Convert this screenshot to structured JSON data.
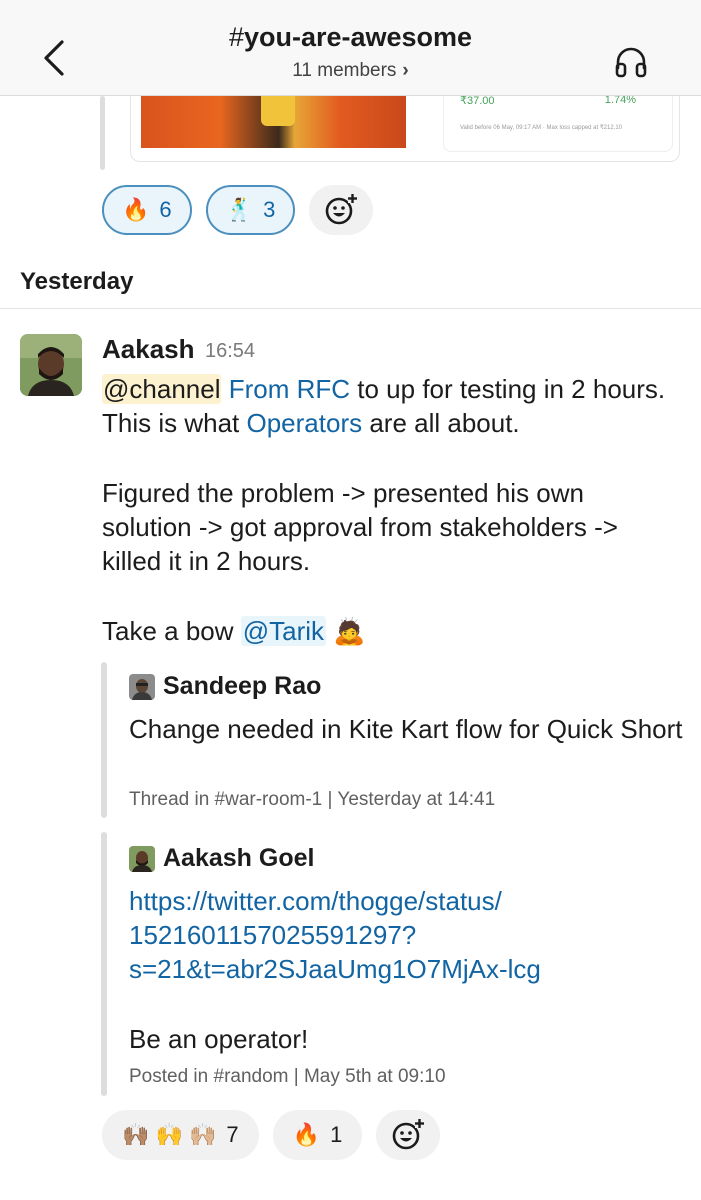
{
  "header": {
    "hash": "#",
    "channel": "you-are-awesome",
    "members": "11 members",
    "members_chevron": "›",
    "back_icon": "chevron-left-icon",
    "audio_icon": "headphones-icon"
  },
  "previous_message": {
    "card_value_left": "₹37.00",
    "card_value_right": "1.74%",
    "card_note": "Valid before 06 May, 09:17 AM · Max loss capped at ₹212.10",
    "reactions": [
      {
        "emoji": "🔥",
        "count": "6",
        "active": true
      },
      {
        "emoji": "🕺",
        "count": "3",
        "active": true
      }
    ]
  },
  "divider_label": "Yesterday",
  "message": {
    "sender": "Aakash",
    "time": "16:54",
    "channel_mention": "@channel",
    "link_rfc": "From RFC",
    "line1_rest": " to up for testing in 2 hours. This is what ",
    "link_operators": "Operators",
    "line1_end": " are all about.",
    "paragraph2": "Figured the problem -> presented his own solution -> got approval from stakeholders -> killed it in 2 hours.",
    "bow_text": "Take a bow ",
    "user_mention": "@Tarik",
    "bow_emoji": "🙇",
    "quotes": [
      {
        "author": "Sandeep Rao",
        "text": "Change needed in Kite Kart flow for Quick Short",
        "meta": "Thread in #war-room-1 | Yesterday at 14:41"
      },
      {
        "author": "Aakash Goel",
        "link": "https://twitter.com/thogge/status/1521601157025591297?s=21&t=abr2SJaaUmg1O7MjAx-lcg",
        "link_line1": "https://twitter.com/thogge/status/",
        "link_line2": "1521601157025591297?",
        "link_line3": "s=21&t=abr2SJaaUmg1O7MjAx-lcg",
        "text": "Be an operator!",
        "meta": "Posted in #random | May 5th at 09:10"
      }
    ],
    "reactions": [
      {
        "emoji": "🙌🏽 🙌 🙌🏼",
        "count": "7"
      },
      {
        "emoji": "🔥",
        "count": "1"
      }
    ],
    "add_reaction_icon": "add-reaction-icon"
  },
  "colors": {
    "link": "#1264a3",
    "channel_highlight": "#fdf2d0",
    "user_highlight": "#e8f5fa",
    "active_reaction_border": "#4a8fbd"
  }
}
